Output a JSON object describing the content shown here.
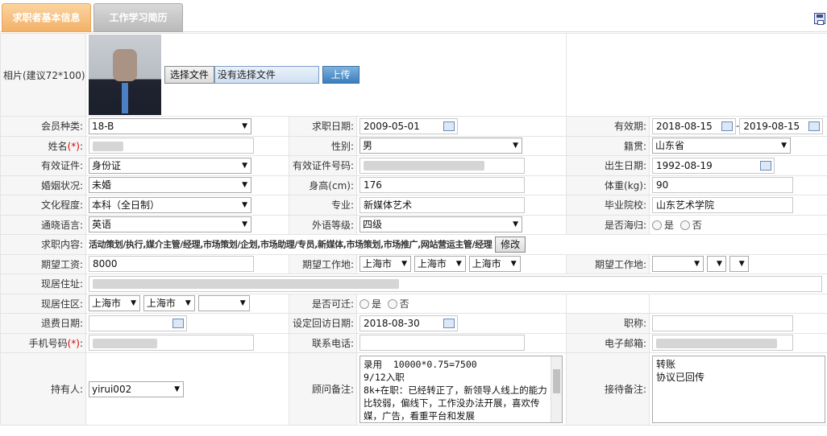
{
  "tabs": [
    "求职者基本信息",
    "工作学习简历"
  ],
  "photo": {
    "label": "相片(建议72*100):",
    "choose_file": "选择文件",
    "no_file": "没有选择文件",
    "upload": "上传"
  },
  "member_type": {
    "label": "会员种类:",
    "value": "18-B"
  },
  "apply_date": {
    "label": "求职日期:",
    "value": "2009-05-01"
  },
  "valid_period": {
    "label": "有效期:",
    "start": "2018-08-15",
    "sep": "-",
    "end": "2019-08-15"
  },
  "name": {
    "label": "姓名",
    "req": "(*)",
    "colon": ":"
  },
  "gender": {
    "label": "性别:",
    "value": "男"
  },
  "native": {
    "label": "籍贯:",
    "value": "山东省"
  },
  "id_type": {
    "label": "有效证件:",
    "value": "身份证"
  },
  "id_no": {
    "label": "有效证件号码:"
  },
  "birth": {
    "label": "出生日期:",
    "value": "1992-08-19"
  },
  "marital": {
    "label": "婚姻状况:",
    "value": "未婚"
  },
  "height": {
    "label": "身高(cm):",
    "value": "176"
  },
  "weight": {
    "label": "体重(kg):",
    "value": "90"
  },
  "education": {
    "label": "文化程度:",
    "value": "本科（全日制）"
  },
  "major": {
    "label": "专业:",
    "value": "新媒体艺术"
  },
  "school": {
    "label": "毕业院校:",
    "value": "山东艺术学院"
  },
  "language": {
    "label": "通晓语言:",
    "value": "英语"
  },
  "foreign_level": {
    "label": "外语等级:",
    "value": "四级"
  },
  "overseas": {
    "label": "是否海归:",
    "yes": "是",
    "no": "否"
  },
  "job_content": {
    "label": "求职内容:",
    "value": "活动策划/执行,媒介主管/经理,市场策划/企划,市场助理/专员,新媒体,市场策划,市场推广,网站营运主管/经理",
    "edit": "修改"
  },
  "salary": {
    "label": "期望工资:",
    "value": "8000"
  },
  "work_place": {
    "label": "期望工作地:",
    "v1": "上海市",
    "v2": "上海市",
    "v3": "上海市"
  },
  "work_place2": {
    "label": "期望工作地:"
  },
  "address": {
    "label": "现居住址:"
  },
  "area": {
    "label": "现居住区:",
    "v1": "上海市",
    "v2": "上海市"
  },
  "relocate": {
    "label": "是否可迁:",
    "yes": "是",
    "no": "否"
  },
  "refund_date": {
    "label": "退费日期:"
  },
  "visit_date": {
    "label": "设定回访日期:",
    "value": "2018-08-30"
  },
  "title": {
    "label": "职称:"
  },
  "mobile": {
    "label": "手机号码",
    "req": "(*)",
    "colon": ":"
  },
  "phone": {
    "label": "联系电话:"
  },
  "email": {
    "label": "电子邮箱:"
  },
  "holder": {
    "label": "持有人:",
    "value": "yirui002"
  },
  "advisor_note": {
    "label": "顾问备注:",
    "value": "录用  10000*0.75=7500\n9/12入职\n8k+在职：已经转正了，新领导人线上的能力比较弱，偏线下，工作没办法开展，喜欢传媒，广告，看重平台和发展"
  },
  "reception_note": {
    "label": "接待备注:",
    "value": "转账\n协议已回传"
  }
}
